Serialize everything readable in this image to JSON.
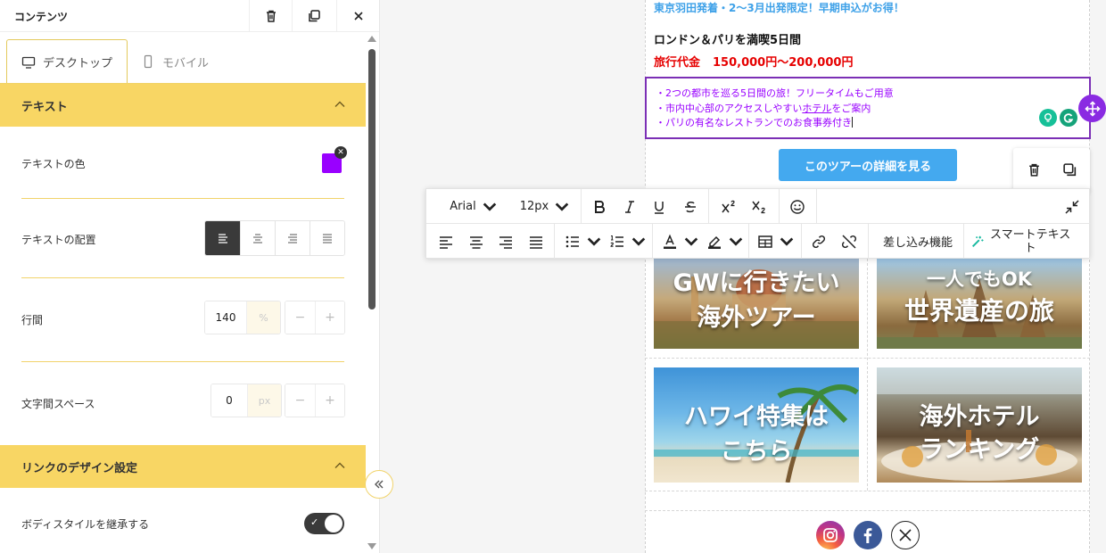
{
  "panel": {
    "title": "コンテンツ",
    "tabs": [
      {
        "label": "デスクトップ"
      },
      {
        "label": "モバイル"
      }
    ],
    "text_section": {
      "title": "テキスト",
      "color_label": "テキストの色",
      "color_value": "#9900ff",
      "align_label": "テキストの配置",
      "align_options": [
        "left",
        "center",
        "right",
        "justify"
      ],
      "align_selected": "left",
      "line_height_label": "行間",
      "line_height_value": "140",
      "line_height_unit": "%",
      "letter_spacing_label": "文字間スペース",
      "letter_spacing_value": "0",
      "letter_spacing_unit": "px"
    },
    "link_section": {
      "title": "リンクのデザイン設定",
      "inherit_label": "ボディスタイルを継承する",
      "inherit_on": true
    },
    "stepper_minus": "−",
    "stepper_plus": "+"
  },
  "email": {
    "headline": "東京羽田発着・2〜3月出発限定！早期申込がお得！",
    "title": "ロンドン＆パリを満喫5日間",
    "price_label": "旅行代金",
    "price_value": "150,000円〜200,000円",
    "bullets": [
      "・2つの都市を巡る5日間の旅！フリータイムもご用意",
      "・市内中心部のアクセスしやすいホテルをご案内",
      "・パリの有名なレストランでのお食事券付き"
    ],
    "bullet2_pre": "・市内中心部のアクセスしやすい",
    "bullet2_link": "ホテル",
    "bullet2_post": "をご案内",
    "cta": "このツアーの詳細を見る",
    "tiles": [
      {
        "line1": "GWに行きたい",
        "line2": "海外ツアー"
      },
      {
        "line1": "一人でもOK",
        "line2": "世界遺産の旅"
      },
      {
        "line1": "ハワイ特集は",
        "line2": "こちら"
      },
      {
        "line1": "海外ホテル",
        "line2": "ランキング"
      }
    ]
  },
  "toolbar": {
    "font": "Arial",
    "size": "12px",
    "merge_label": "差し込み機能",
    "smart_label_1": "スマートテキス",
    "smart_label_2": "ト"
  },
  "colors": {
    "accent_yellow": "#f8d664",
    "text_purple": "#9900ff",
    "cta_blue": "#44a9ef",
    "price_red": "#e60000",
    "headline_blue": "#3ea1e8"
  }
}
